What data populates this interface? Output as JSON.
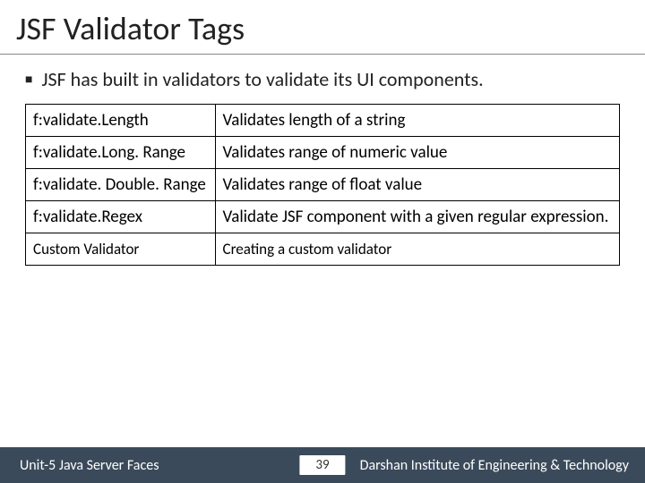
{
  "title": "JSF Validator Tags",
  "bullet": "JSF has built in validators to validate its UI components.",
  "table": {
    "rows": [
      {
        "tag": "f:validate.Length",
        "desc": "Validates length of a string"
      },
      {
        "tag": "f:validate.Long. Range",
        "desc": "Validates range of numeric value"
      },
      {
        "tag": "f:validate. Double. Range",
        "desc": "Validates range of float value"
      },
      {
        "tag": "f:validate.Regex",
        "desc": "Validate JSF component with a given regular expression."
      },
      {
        "tag": "Custom Validator",
        "desc": "Creating a custom validator"
      }
    ]
  },
  "footer": {
    "left": "Unit-5 Java Server Faces",
    "page": "39",
    "right": "Darshan Institute of Engineering & Technology"
  }
}
